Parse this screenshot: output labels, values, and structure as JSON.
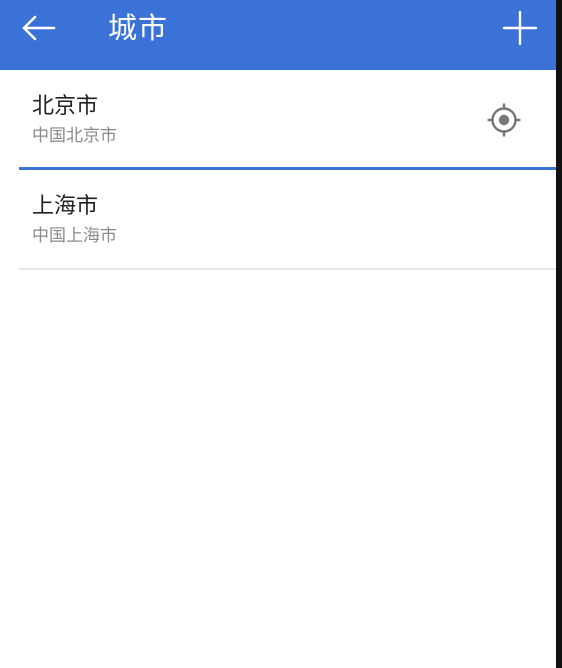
{
  "appbar": {
    "title": "城市",
    "back_icon": "arrow-left-icon",
    "add_icon": "plus-icon",
    "color": "#3a72d8"
  },
  "cities": [
    {
      "name": "北京市",
      "description": "中国北京市",
      "selected": true,
      "icon": "location-target-icon"
    },
    {
      "name": "上海市",
      "description": "中国上海市",
      "selected": false
    }
  ]
}
